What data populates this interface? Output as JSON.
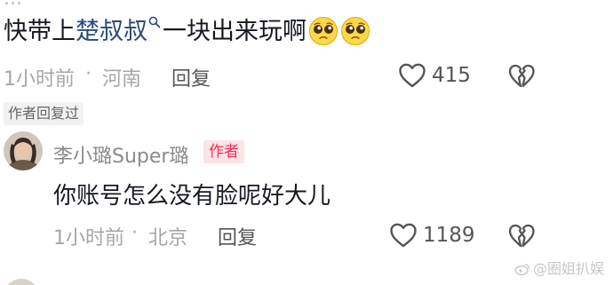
{
  "first_comment": {
    "cut_off_text": "...",
    "prefix": "快带上",
    "mention": "楚叔叔",
    "suffix": "一块出来玩啊",
    "emoji_icon": "pleading-face-emoji",
    "emoji_count": 2,
    "time": "1小时前",
    "separator": "·",
    "location": "河南",
    "reply_label": "回复",
    "likes": "415"
  },
  "author_replied_tag": "作者回复过",
  "reply_comment": {
    "username": "李小璐Super璐",
    "badge": "作者",
    "text": "你账号怎么没有脸呢好大儿",
    "time": "1小时前",
    "separator": "·",
    "location": "北京",
    "reply_label": "回复",
    "likes": "1189"
  },
  "watermark": "@圈姐扒娱",
  "colors": {
    "text_primary": "#161823",
    "text_secondary": "#a6a6a6",
    "mention": "#2c4a7a",
    "author_badge": "#fe2c55"
  }
}
